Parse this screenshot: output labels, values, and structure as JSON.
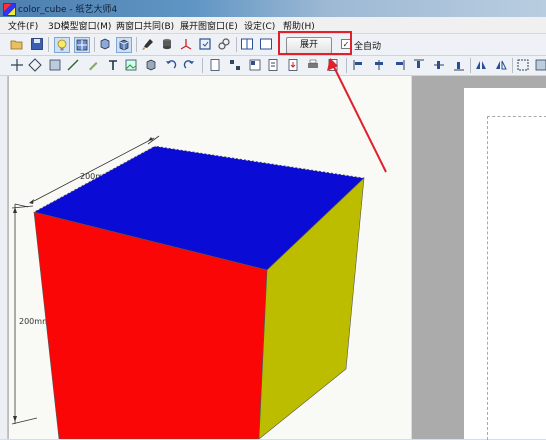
{
  "window": {
    "title": "color_cube - 纸艺大师4"
  },
  "menu": [
    "文件(F)",
    "3D模型窗口(M)",
    "两窗口共同(B)",
    "展开图窗口(E)",
    "设定(C)",
    "帮助(H)"
  ],
  "toolbar": {
    "expand_label": "展开",
    "auto_label": "全自动",
    "auto_checked": "✓"
  },
  "model": {
    "dimension_top": "200mm",
    "dimension_left": "200mm",
    "colors": {
      "top": "#0b0bd6",
      "front": "#fb0606",
      "side": "#bdbd00"
    }
  },
  "annotation": {
    "color": "#e0202a"
  }
}
